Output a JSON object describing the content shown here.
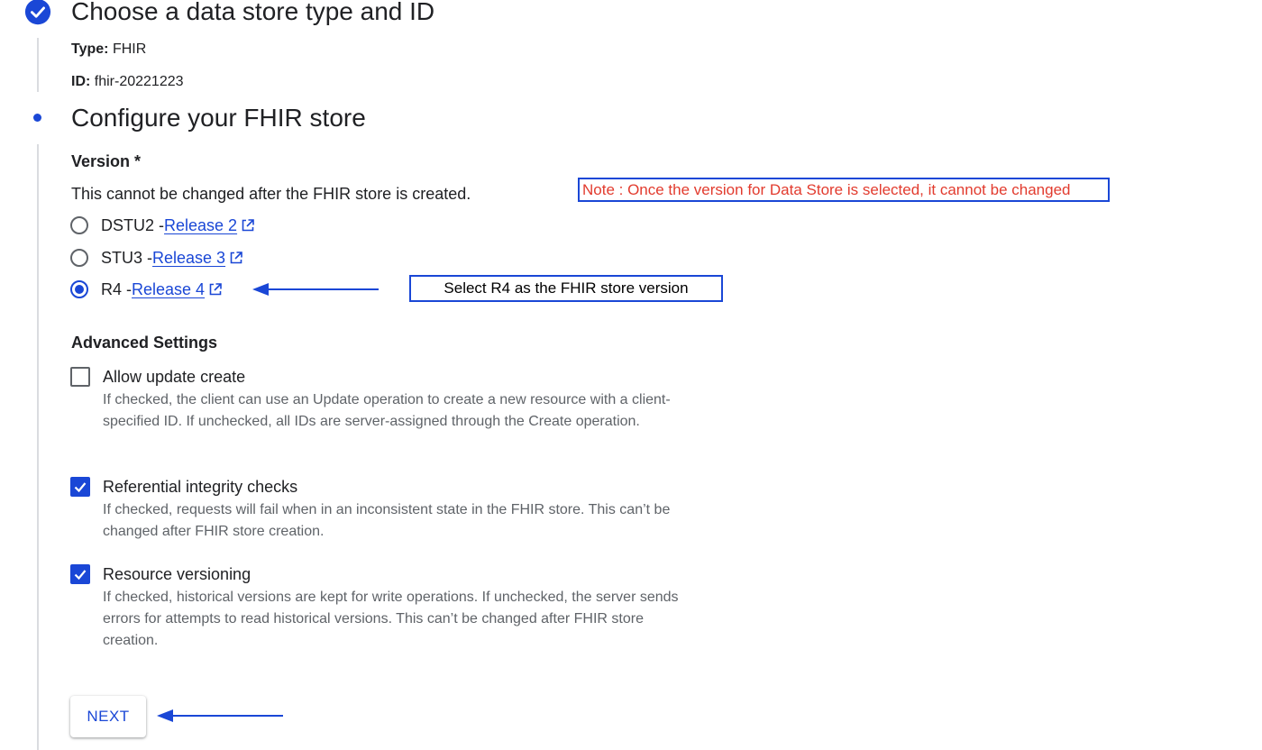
{
  "step1": {
    "title": "Choose a data store type and ID",
    "type_label": "Type:",
    "type_value": "FHIR",
    "id_label": "ID:",
    "id_value": "fhir-20221223"
  },
  "step2": {
    "title": "Configure your FHIR store",
    "version_label": "Version *",
    "version_hint": "This cannot be changed after the FHIR store is created.",
    "versions": [
      {
        "prefix": "DSTU2 -",
        "link": "Release 2",
        "selected": false
      },
      {
        "prefix": "STU3 -",
        "link": "Release 3",
        "selected": false
      },
      {
        "prefix": "R4 -",
        "link": "Release 4",
        "selected": true
      }
    ],
    "advanced_label": "Advanced Settings",
    "settings": [
      {
        "title": "Allow update create",
        "desc": "If checked, the client can use an Update operation to create a new resource with a client-specified ID. If unchecked, all IDs are server-assigned through the Create operation.",
        "checked": false
      },
      {
        "title": "Referential integrity checks",
        "desc": "If checked, requests will fail when in an inconsistent state in the FHIR store. This can’t be changed after FHIR store creation.",
        "checked": true
      },
      {
        "title": "Resource versioning",
        "desc": "If checked, historical versions are kept for write operations. If unchecked, the server sends errors for attempts to read historical versions. This can’t be changed after FHIR store creation.",
        "checked": true
      }
    ],
    "next_label": "NEXT"
  },
  "annotations": {
    "note": "Note : Once the version for Data Store is selected, it cannot be changed",
    "callout": "Select R4 as the FHIR store version"
  },
  "colors": {
    "accent": "#1a47d6",
    "note_text": "#e23b2e",
    "text": "#202124",
    "secondary_text": "#5f6368"
  },
  "icons": [
    "check-circle-icon",
    "external-link-icon",
    "checkbox-check-icon",
    "arrow-left-icon"
  ]
}
